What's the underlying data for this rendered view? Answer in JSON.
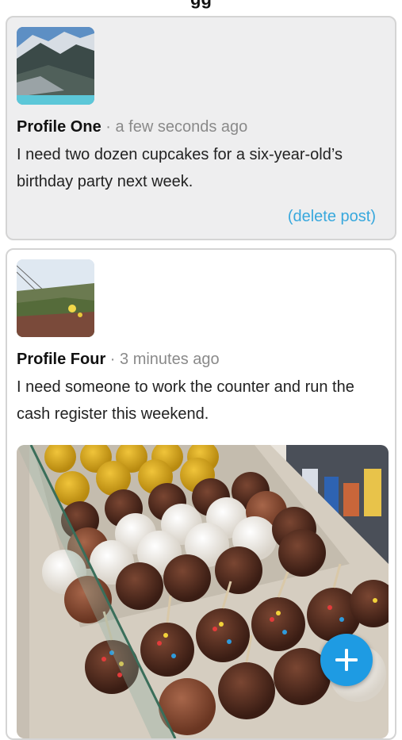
{
  "header": {
    "title_fragment": "gg"
  },
  "posts": [
    {
      "author": "Profile One",
      "separator": " · ",
      "time": "a few seconds ago",
      "text": "I need two dozen cupcakes for a six-year-old’s birthday party next week.",
      "delete_label": "(delete post)",
      "avatar_icon": "mountain-landscape-thumbnail"
    },
    {
      "author": "Profile Four",
      "separator": " · ",
      "time": "3 minutes ago",
      "text": "I need someone to work the counter and run the cash register this weekend.",
      "avatar_icon": "coastal-flowers-thumbnail",
      "image_icon": "candy-apples-display-photo"
    }
  ],
  "fab": {
    "icon": "plus-icon",
    "color": "#1e9be3"
  },
  "colors": {
    "link": "#38a8dd",
    "meta": "#8a8a8a",
    "card_one_bg": "#eeeeef"
  }
}
